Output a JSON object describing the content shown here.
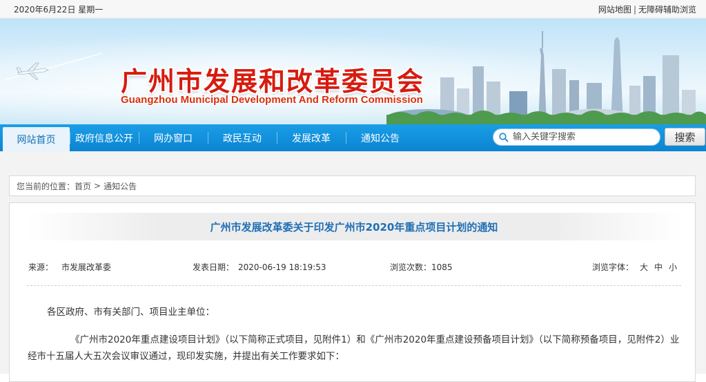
{
  "topbar": {
    "date": "2020年6月22日 星期一",
    "links": [
      "网站地图",
      "无障碍辅助浏览"
    ],
    "separator": "|"
  },
  "banner": {
    "title_cn": "广州市发展和改革委员会",
    "title_en": "Guangzhou Municipal Development And Reform Commission"
  },
  "nav": {
    "items": [
      "网站首页",
      "政府信息公开",
      "网办窗口",
      "政民互动",
      "发展改革",
      "通知公告"
    ],
    "active_index": 0,
    "search_placeholder": "输入关键字搜索",
    "search_button": "搜索"
  },
  "breadcrumb": {
    "prefix": "您当前的位置：",
    "home": "首页",
    "separator": ">",
    "current": "通知公告"
  },
  "article": {
    "title": "广州市发展改革委关于印发广州市2020年重点项目计划的通知",
    "source_label": "来源：",
    "source": "市发展改革委",
    "date_label": "发表日期：",
    "date": "2020-06-19 18:19:53",
    "views_label": "浏览次数：",
    "views": "1085",
    "font_label": "浏览字体：",
    "font_sizes": [
      "大",
      "中",
      "小"
    ],
    "paragraphs": [
      "各区政府、市有关部门、项目业主单位：",
      "《广州市2020年重点建设项目计划》（以下简称正式项目，见附件1）和《广州市2020年重点建设预备项目计划》（以下简称预备项目，见附件2）业经市十五届人大五次会议审议通过，现印发实施，并提出有关工作要求如下："
    ]
  },
  "colors": {
    "nav_blue": "#0b84d2",
    "title_red": "#d61c10",
    "article_title_blue": "#1f6fb5"
  }
}
